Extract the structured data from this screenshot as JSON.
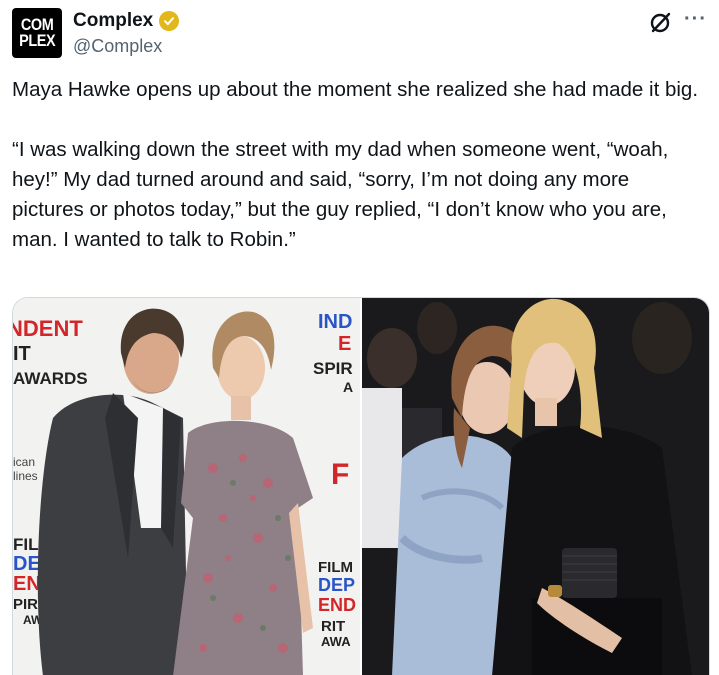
{
  "account": {
    "avatar_line1": "COM",
    "avatar_line2": "PLEX",
    "display_name": "Complex",
    "handle": "@Complex",
    "verified_color": "#e2b719"
  },
  "actions": {
    "grok_icon": "grok-slash-icon",
    "more_label": "···"
  },
  "tweet": {
    "paragraph1": "Maya Hawke opens up about the moment she realized she had made it big.",
    "paragraph2": "“I was walking down the street with my dad when someone went, “woah, hey!” My dad turned around and said, “sorry, I’m not doing any more pictures or photos today,” but the guy replied, “I don’t know who you are, man. I wanted to talk to Robin.”"
  },
  "media": {
    "photo1": {
      "backdrop_words": [
        "NDENT",
        "IT",
        "AWARDS",
        "ican",
        "lines",
        "FIL",
        "DE",
        "EN",
        "PIRIT",
        "AWA",
        "IND",
        "E",
        "SPIR",
        "A",
        "FILM",
        "DEP",
        "END",
        "RIT",
        "AWA",
        "F"
      ]
    },
    "photo2": {}
  }
}
